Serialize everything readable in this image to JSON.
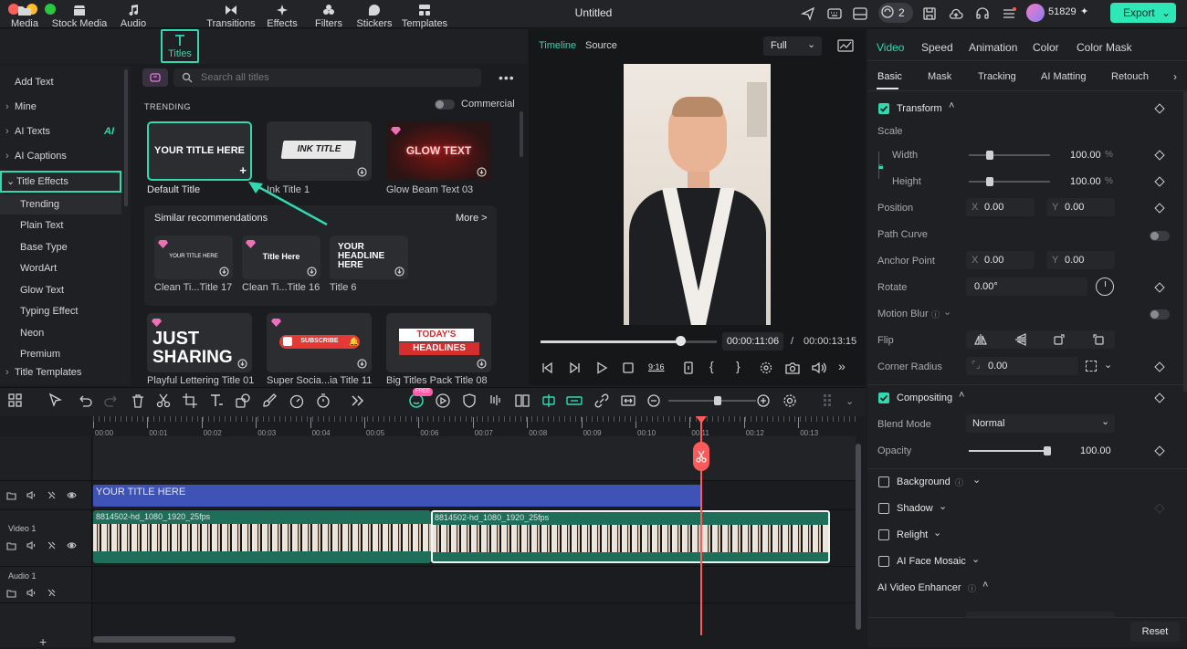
{
  "window": {
    "title": "Untitled"
  },
  "header": {
    "credits": "2",
    "points": "51829",
    "export_label": "Export"
  },
  "media_tabs": [
    {
      "label": "Media"
    },
    {
      "label": "Stock Media"
    },
    {
      "label": "Audio"
    },
    {
      "label": "Titles"
    },
    {
      "label": "Transitions"
    },
    {
      "label": "Effects"
    },
    {
      "label": "Filters"
    },
    {
      "label": "Stickers"
    },
    {
      "label": "Templates"
    }
  ],
  "left_nav": {
    "add_text": "Add Text",
    "mine": "Mine",
    "ai_texts": "AI Texts",
    "ai_badge": "AI",
    "ai_captions": "AI Captions",
    "title_effects": "Title Effects",
    "sub_items": [
      "Trending",
      "Plain Text",
      "Base Type",
      "WordArt",
      "Glow Text",
      "Typing Effect",
      "Neon",
      "Premium"
    ],
    "title_templates": "Title Templates"
  },
  "titles_panel": {
    "search_placeholder": "Search all titles",
    "section": "TRENDING",
    "commercial_label": "Commercial",
    "cards": [
      {
        "thumb": "YOUR TITLE HERE",
        "caption": "Default Title"
      },
      {
        "thumb": "INK TITLE",
        "caption": "Ink Title 1"
      },
      {
        "thumb": "GLOW TEXT",
        "caption": "Glow Beam Text 03"
      }
    ],
    "similar": {
      "heading": "Similar recommendations",
      "more": "More >",
      "cards": [
        {
          "thumb": "YOUR TITLE HERE",
          "caption": "Clean Ti...Title 17"
        },
        {
          "thumb": "Title Here",
          "caption": "Clean Ti...Title 16"
        },
        {
          "thumb": "YOUR HEADLINE HERE",
          "caption": "Title 6"
        }
      ]
    },
    "bottom_cards": [
      {
        "thumb1": "JUST",
        "thumb2": "SHARING",
        "caption": "Playful Lettering Title 01"
      },
      {
        "thumb": "SUBSCRIBE",
        "caption": "Super Socia...ia Title 11"
      },
      {
        "thumb1": "TODAY'S",
        "thumb2": "HEADLINES",
        "caption": "Big Titles Pack Title 08"
      }
    ]
  },
  "preview": {
    "tab_timeline": "Timeline",
    "tab_source": "Source",
    "zoom": "Full",
    "current_time": "00:00:11:06",
    "separator": "/",
    "total_time": "00:00:13:15",
    "progress": 0.8,
    "aspect_label": "9:16"
  },
  "inspector": {
    "tabs": [
      "Video",
      "Speed",
      "Animation",
      "Color",
      "Color Mask"
    ],
    "subtabs": [
      "Basic",
      "Mask",
      "Tracking",
      "AI Matting",
      "Retouch"
    ],
    "transform": "Transform",
    "scale": "Scale",
    "width_label": "Width",
    "width_value": "100.00",
    "height_label": "Height",
    "height_value": "100.00",
    "percent": "%",
    "position": "Position",
    "pos_x": "0.00",
    "pos_y": "0.00",
    "x_label": "X",
    "y_label": "Y",
    "path_curve": "Path Curve",
    "anchor_point": "Anchor Point",
    "anchor_x": "0.00",
    "anchor_y": "0.00",
    "rotate": "Rotate",
    "rotate_value": "0.00°",
    "motion_blur": "Motion Blur",
    "flip": "Flip",
    "corner_radius": "Corner Radius",
    "corner_value": "0.00",
    "compositing": "Compositing",
    "blend_mode": "Blend Mode",
    "blend_value": "Normal",
    "opacity": "Opacity",
    "opacity_value": "100.00",
    "background": "Background",
    "shadow": "Shadow",
    "relight": "Relight",
    "face_mosaic": "AI Face Mosaic",
    "enhancer": "AI Video Enhancer",
    "reset": "Reset"
  },
  "timeline": {
    "new_badge": "FREE",
    "ruler": [
      "00:00",
      "00:01",
      "00:02",
      "00:03",
      "00:04",
      "00:05",
      "00:06",
      "00:07",
      "00:08",
      "00:09",
      "00:10",
      "00:11",
      "00:12",
      "00:13"
    ],
    "title_clip": "YOUR TITLE HERE",
    "video_track": "Video 1",
    "audio_track": "Audio 1",
    "clip_a": "8814502-hd_1080_1920_25fps",
    "clip_b": "8814502-hd_1080_1920_25fps"
  }
}
